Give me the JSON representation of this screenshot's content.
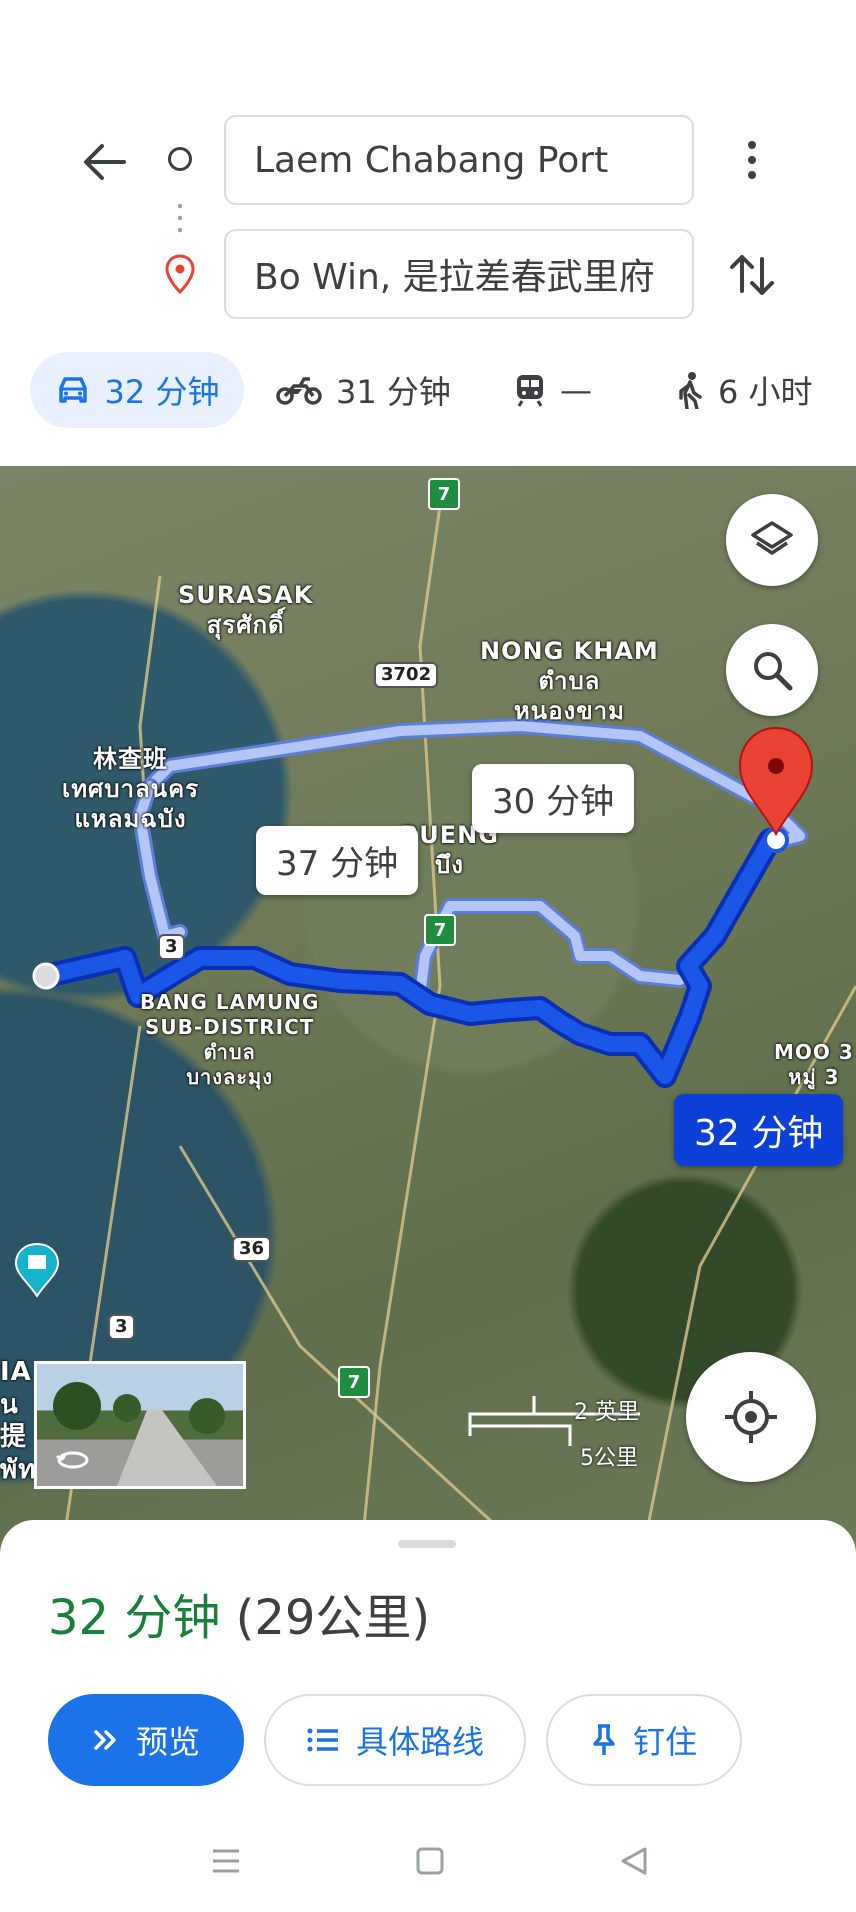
{
  "header": {
    "back_icon": "arrow-left-icon",
    "origin_value": "Laem Chabang Port",
    "destination_value": "Bo Win, 是拉差春武里府",
    "more_icon": "more-vert-icon",
    "swap_icon": "swap-vert-icon"
  },
  "modes": [
    {
      "icon": "car-icon",
      "label": "32 分钟",
      "active": true
    },
    {
      "icon": "motorcycle-icon",
      "label": "31 分钟"
    },
    {
      "icon": "transit-icon",
      "label": "—"
    },
    {
      "icon": "walk-icon",
      "label": "6 小时"
    }
  ],
  "map": {
    "labels": {
      "surasak_en": "SURASAK",
      "surasak_th": "สุรศักดิ์",
      "nongkham_en": "NONG KHAM",
      "nongkham_th1": "ตำบล",
      "nongkham_th2": "หนองขาม",
      "laem_cn": "林查班",
      "laem_th1": "เทศบาลนคร",
      "laem_th2": "แหลมฉบัง",
      "bueng_en": "BUENG",
      "bueng_th": "บึง",
      "bang_en1": "BANG LAMUNG",
      "bang_en2": "SUB-DISTRICT",
      "bang_th1": "ตำบล",
      "bang_th2": "บางละมุง",
      "moo_en": "MOO 3",
      "moo_th": "หมู่ 3",
      "edge_a": "IA",
      "edge_b": "น",
      "edge_c": "提",
      "edge_d": "พัทยา"
    },
    "shields": {
      "r3702": "3702",
      "r3a": "3",
      "r3b": "3",
      "r36": "36",
      "hw": "7"
    },
    "bubbles": {
      "alt1": "30 分钟",
      "alt2": "37 分钟",
      "primary": "32 分钟"
    },
    "scale": {
      "miles": "2 英里",
      "km": "5公里"
    },
    "buttons": {
      "layers_icon": "layers-icon",
      "search_icon": "search-icon",
      "locate_icon": "my-location-icon"
    }
  },
  "sheet": {
    "duration": "32 分钟",
    "distance": "(29公里)",
    "actions": {
      "preview": "预览",
      "steps": "具体路线",
      "pin": "钉住"
    }
  },
  "colors": {
    "primary_route": "#1a56e8",
    "alt_route": "#a9bdf5",
    "accent": "#1a73e8",
    "duration_green": "#188038",
    "dest_pin": "#ea4335"
  }
}
